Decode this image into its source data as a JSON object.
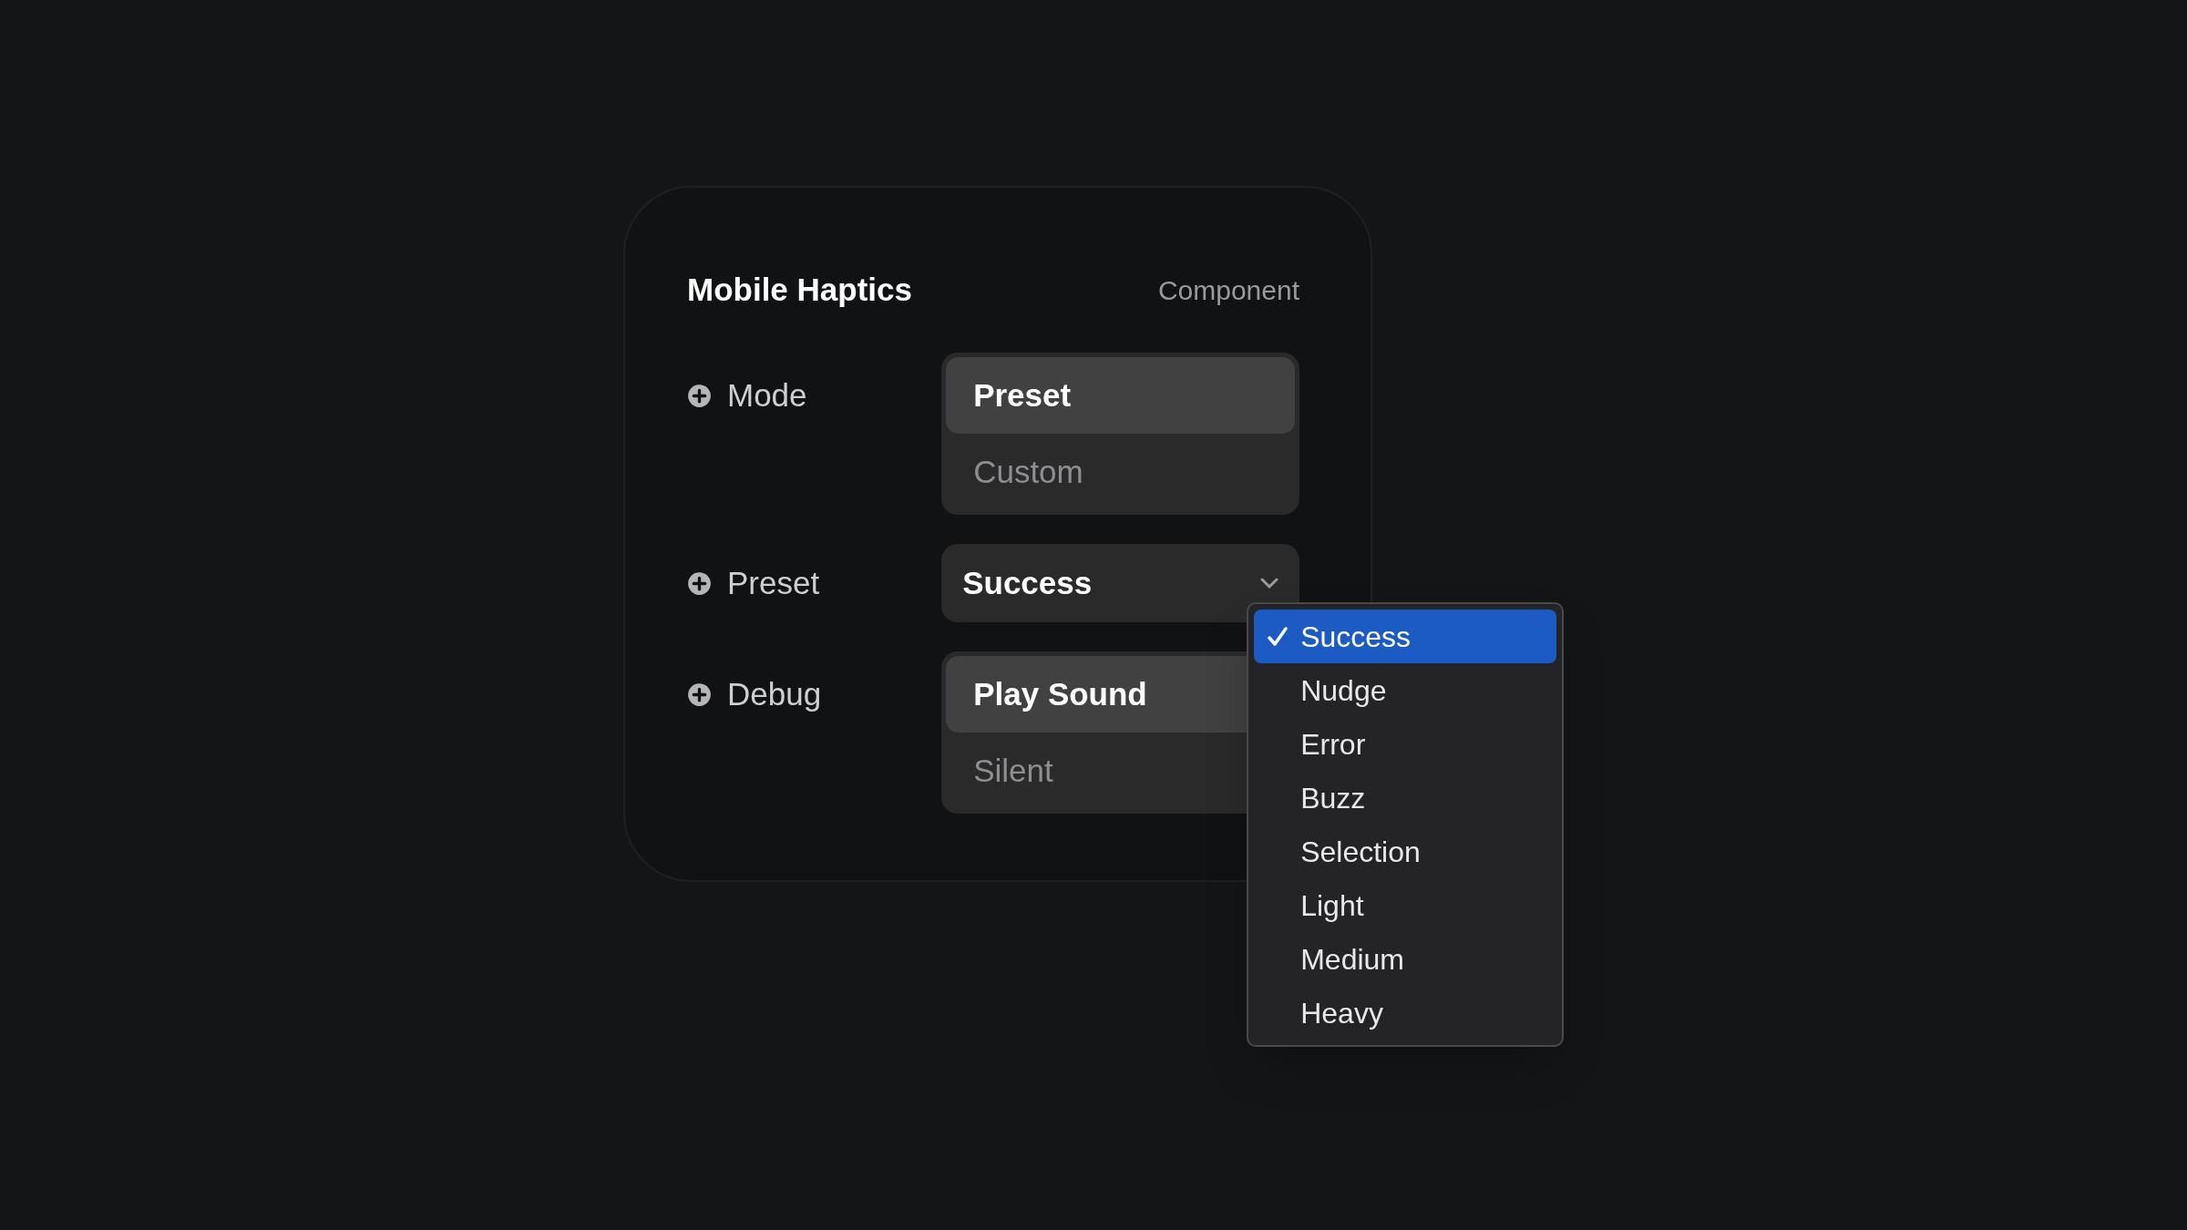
{
  "card": {
    "title": "Mobile Haptics",
    "subtitle": "Component"
  },
  "rows": [
    {
      "kind": "segmented",
      "label": "Mode",
      "options": [
        {
          "label": "Preset",
          "selected": true
        },
        {
          "label": "Custom",
          "selected": false
        }
      ]
    },
    {
      "kind": "select",
      "label": "Preset",
      "value": "Success",
      "expanded": true,
      "menu": [
        {
          "label": "Success",
          "selected": true
        },
        {
          "label": "Nudge",
          "selected": false
        },
        {
          "label": "Error",
          "selected": false
        },
        {
          "label": "Buzz",
          "selected": false
        },
        {
          "label": "Selection",
          "selected": false
        },
        {
          "label": "Light",
          "selected": false
        },
        {
          "label": "Medium",
          "selected": false
        },
        {
          "label": "Heavy",
          "selected": false
        }
      ]
    },
    {
      "kind": "segmented",
      "label": "Debug",
      "options": [
        {
          "label": "Play Sound",
          "selected": true
        },
        {
          "label": "Silent",
          "selected": false
        }
      ]
    }
  ]
}
